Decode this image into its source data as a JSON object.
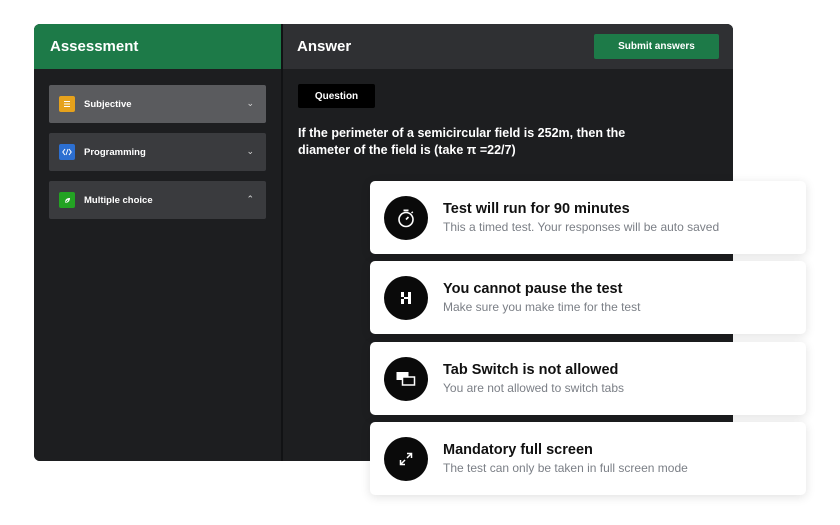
{
  "left_panel": {
    "title": "Assessment",
    "categories": [
      {
        "label": "Subjective",
        "icon": "document-icon",
        "color": "#e6a21c",
        "chevron": "⌄"
      },
      {
        "label": "Programming",
        "icon": "code-icon",
        "color": "#2c6fd1",
        "chevron": "⌄"
      },
      {
        "label": "Multiple choice",
        "icon": "check-leaf-icon",
        "color": "#23a323",
        "chevron": "⌃"
      }
    ]
  },
  "right_panel": {
    "title": "Answer",
    "submit_label": "Submit answers",
    "question_tag": "Question",
    "question_text": "If the perimeter of a semicircular field is 252m, then the diameter of the field is (take π =22/7)"
  },
  "info_cards": [
    {
      "title": "Test will run for 90 minutes",
      "subtitle": "This a timed test. Your responses will be auto saved",
      "icon": "stopwatch-icon"
    },
    {
      "title": "You cannot pause the test",
      "subtitle": "Make sure you make time for the test",
      "icon": "pause-icon"
    },
    {
      "title": "Tab Switch is not allowed",
      "subtitle": "You are not allowed to switch tabs",
      "icon": "tab-switch-icon"
    },
    {
      "title": "Mandatory full screen",
      "subtitle": "The test can only be taken in full screen mode",
      "icon": "fullscreen-icon"
    }
  ],
  "colors": {
    "brand_green": "#1d7a48",
    "panel_dark": "#1d1e20",
    "header_gray": "#2f3033"
  }
}
